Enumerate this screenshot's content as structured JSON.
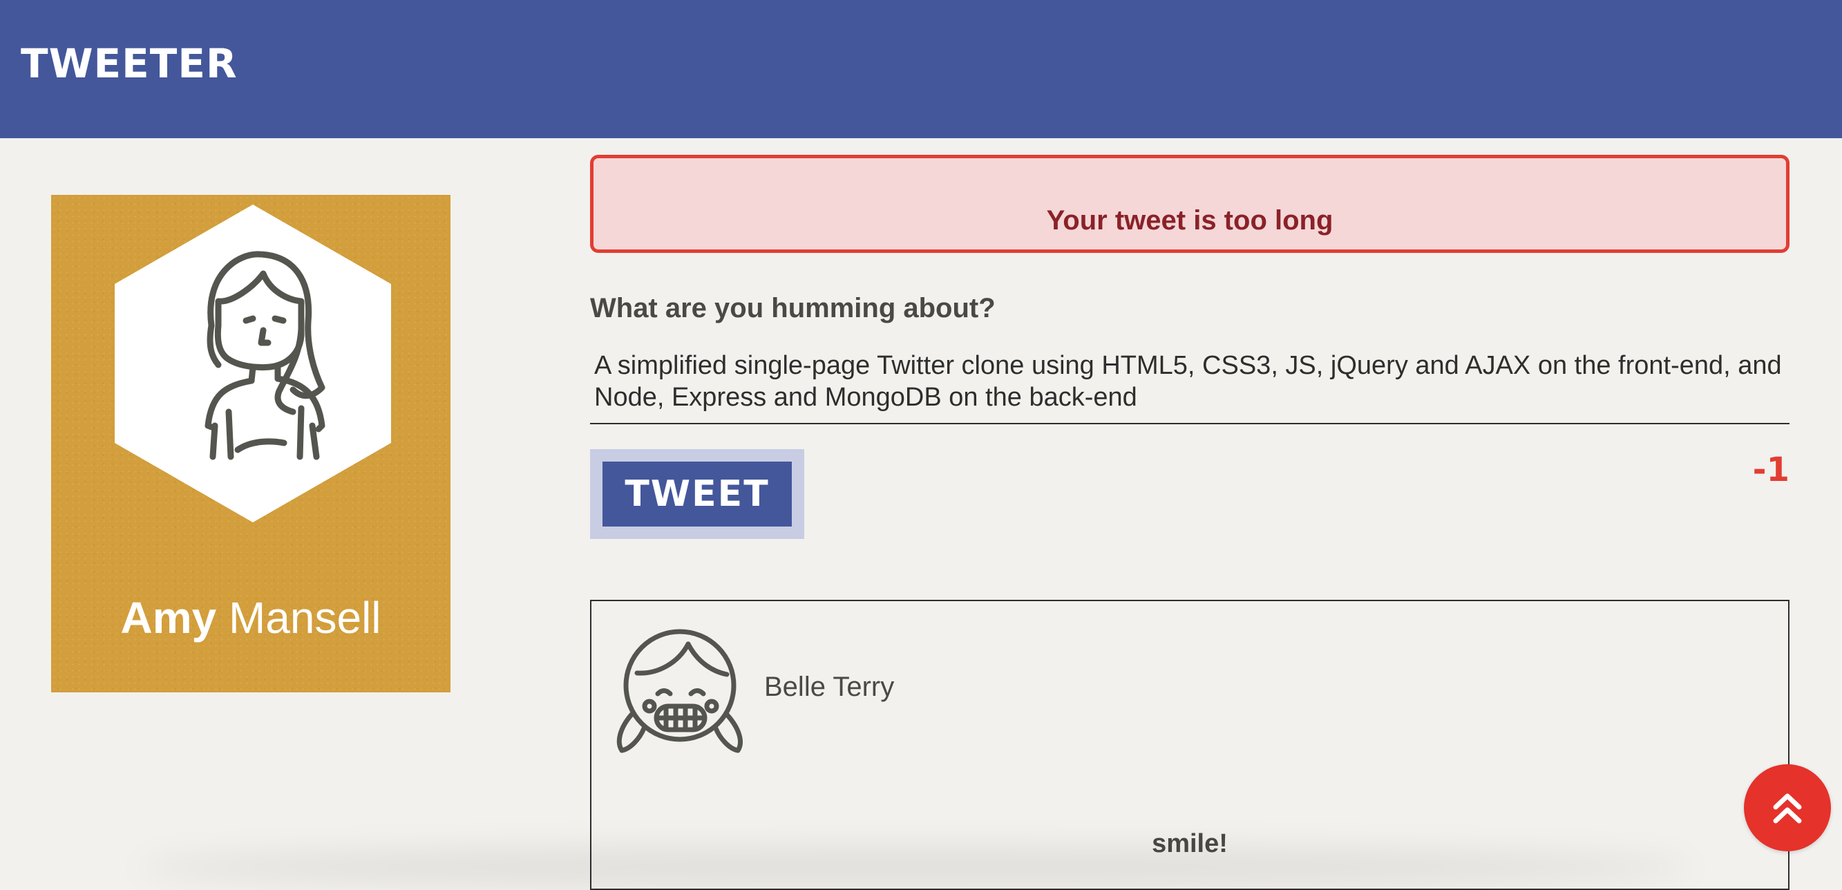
{
  "header": {
    "brand": "TWEETER",
    "background_color": "#44579b"
  },
  "profile": {
    "first_name": "Amy",
    "last_name": "Mansell",
    "card_color": "#d39e3c",
    "avatar_icon": "woman-avatar-icon"
  },
  "error": {
    "message": "Your tweet is too long",
    "border_color": "#e23d32",
    "background_color": "#f5d7d8"
  },
  "compose": {
    "label": "What are you humming about?",
    "text": "A simplified single-page Twitter clone using HTML5, CSS3, JS, jQuery and AJAX on the front-end, and Node, Express and MongoDB on the back-end",
    "button_label": "TWEET",
    "counter": "-1",
    "counter_color": "#e23d32"
  },
  "tweets": [
    {
      "author": "Belle Terry",
      "content": "smile!",
      "avatar_icon": "girl-smiling-avatar-icon"
    }
  ],
  "scroll_top": {
    "icon": "double-chevron-up-icon",
    "color": "#e5322b"
  }
}
